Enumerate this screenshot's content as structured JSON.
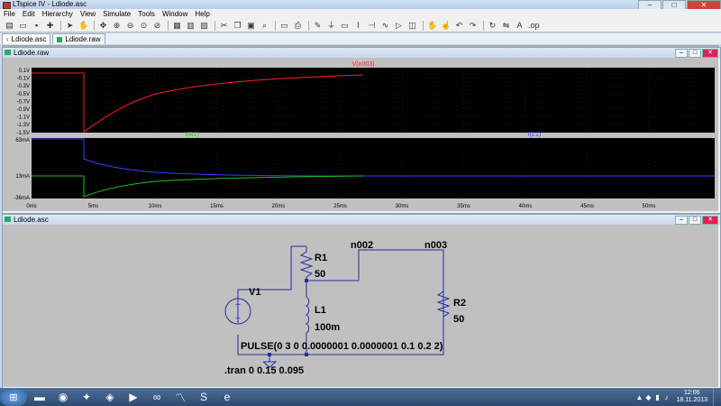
{
  "app": {
    "title": "LTspice IV - Ldiode.asc"
  },
  "window_buttons": [
    "–",
    "□",
    "✕"
  ],
  "menu": [
    "File",
    "Edit",
    "Hierarchy",
    "View",
    "Simulate",
    "Tools",
    "Window",
    "Help"
  ],
  "toolbar_icons": [
    "new-schematic-icon",
    "open-icon",
    "save-icon",
    "control-panel-icon",
    "run-icon",
    "halt-icon",
    "pan-icon",
    "zoom-in-icon",
    "zoom-out-icon",
    "zoom-fit-icon",
    "zoom-cancel-icon",
    "tile-horizontal-icon",
    "tile-vertical-icon",
    "cascade-icon",
    "cut-icon",
    "copy-icon",
    "paste-icon",
    "find-icon",
    "print-setup-icon",
    "print-icon",
    "wire-icon",
    "ground-icon",
    "label-icon",
    "resistor-icon",
    "capacitor-icon",
    "inductor-icon",
    "diode-icon",
    "component-icon",
    "move-icon",
    "drag-icon",
    "undo-icon",
    "redo-icon",
    "rotate-icon",
    "mirror-icon",
    "text-icon",
    "spice-directive-icon"
  ],
  "tabs": [
    {
      "label": "Ldiode.asc",
      "active": true
    },
    {
      "label": "Ldiode.raw",
      "active": false
    }
  ],
  "waveform": {
    "title": "Ldiode.raw",
    "pane1": {
      "trace": "V(n003)",
      "color": "#ff2020",
      "ylabels": [
        "0.1V",
        "-0.1V",
        "-0.3V",
        "-0.5V",
        "-0.7V",
        "-0.9V",
        "-1.1V",
        "-1.3V",
        "-1.5V"
      ]
    },
    "pane2": {
      "traces": [
        {
          "name": "I(R2)",
          "color": "#20c020"
        },
        {
          "name": "I(L1)",
          "color": "#3040ff"
        }
      ],
      "ylabels": [
        "63mA",
        "13mA",
        "-36mA"
      ]
    },
    "xlabels": [
      "0ms",
      "5ms",
      "10ms",
      "15ms",
      "20ms",
      "25ms",
      "30ms",
      "35ms",
      "40ms",
      "45ms",
      "50ms"
    ]
  },
  "schematic": {
    "title": "Ldiode.asc",
    "r1": {
      "name": "R1",
      "value": "50"
    },
    "l1": {
      "name": "L1",
      "value": "100m"
    },
    "r2": {
      "name": "R2",
      "value": "50"
    },
    "v1": {
      "name": "V1",
      "value": "PULSE(0 3 0 0.0000001 0.0000001 0.1 0.2 2)"
    },
    "net1": "n002",
    "net2": "n003",
    "directive": ".tran 0 0.15 0.095"
  },
  "taskbar": {
    "items": [
      "folder-icon",
      "chrome-icon",
      "tool-icon",
      "app-icon",
      "media-icon",
      "visual-studio-icon",
      "pulse-app-icon",
      "skype-icon",
      "explorer-icon"
    ],
    "time": "12:06",
    "date": "18.11.2013"
  }
}
